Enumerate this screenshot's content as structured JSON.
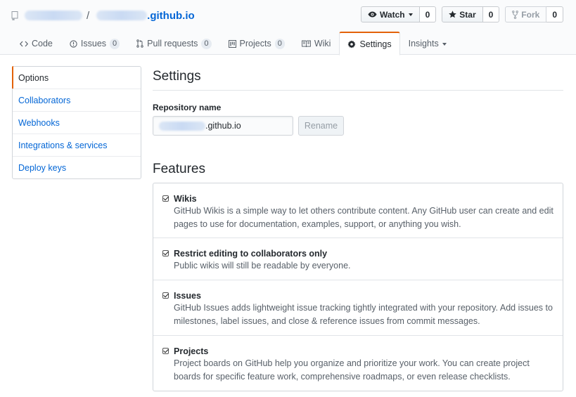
{
  "repo": {
    "separator": "/",
    "name_suffix": ".github.io"
  },
  "actions": {
    "watch": {
      "label": "Watch",
      "count": "0"
    },
    "star": {
      "label": "Star",
      "count": "0"
    },
    "fork": {
      "label": "Fork",
      "count": "0"
    }
  },
  "tabs": [
    {
      "label": "Code"
    },
    {
      "label": "Issues",
      "count": "0"
    },
    {
      "label": "Pull requests",
      "count": "0"
    },
    {
      "label": "Projects",
      "count": "0"
    },
    {
      "label": "Wiki"
    },
    {
      "label": "Settings"
    },
    {
      "label": "Insights"
    }
  ],
  "sidebar": {
    "items": [
      {
        "label": "Options"
      },
      {
        "label": "Collaborators"
      },
      {
        "label": "Webhooks"
      },
      {
        "label": "Integrations & services"
      },
      {
        "label": "Deploy keys"
      }
    ]
  },
  "settings": {
    "title": "Settings",
    "repo_name_label": "Repository name",
    "repo_name_value_suffix": ".github.io",
    "rename_label": "Rename"
  },
  "features": {
    "title": "Features",
    "items": [
      {
        "title": "Wikis",
        "checked": true,
        "note": "GitHub Wikis is a simple way to let others contribute content. Any GitHub user can create and edit pages to use for documentation, examples, support, or anything you wish."
      },
      {
        "title": "Restrict editing to collaborators only",
        "checked": true,
        "note": "Public wikis will still be readable by everyone."
      },
      {
        "title": "Issues",
        "checked": true,
        "note": "GitHub Issues adds lightweight issue tracking tightly integrated with your repository. Add issues to milestones, label issues, and close & reference issues from commit messages."
      },
      {
        "title": "Projects",
        "checked": true,
        "note": "Project boards on GitHub help you organize and prioritize your work. You can create project boards for specific feature work, comprehensive roadmaps, or even release checklists."
      }
    ]
  },
  "colors": {
    "link": "#0366d6",
    "accent": "#e36209",
    "text": "#24292e",
    "muted": "#586069",
    "border": "#d1d5da"
  }
}
